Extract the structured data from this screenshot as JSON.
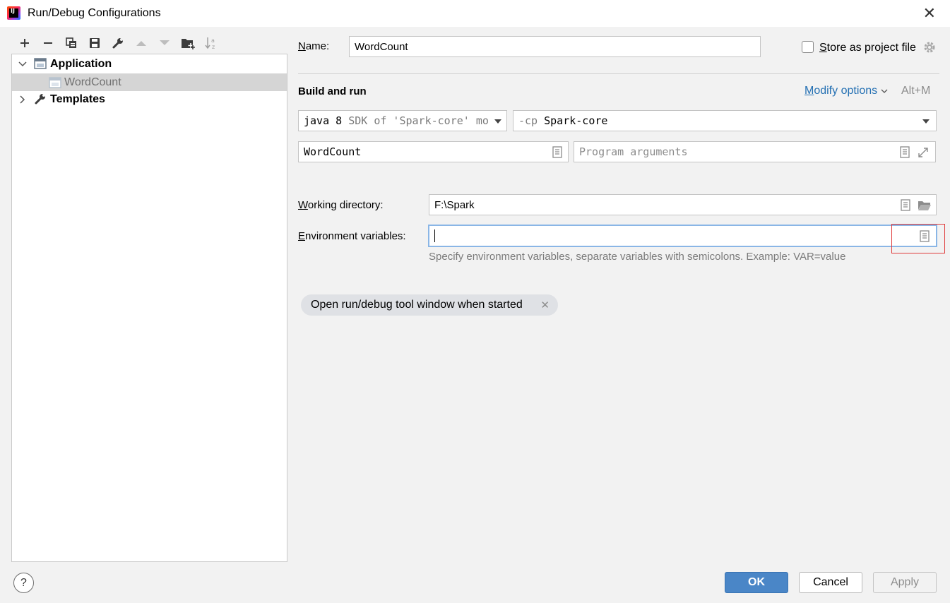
{
  "window": {
    "title": "Run/Debug Configurations",
    "app_icon_text": "IJ"
  },
  "toolbar": {
    "buttons": [
      "plus-icon",
      "minus-icon",
      "copy-icon",
      "save-icon",
      "wrench-icon",
      "arrow-up-icon",
      "arrow-down-icon",
      "new-folder-icon",
      "sort-alpha-icon"
    ]
  },
  "tree": {
    "application_label": "Application",
    "wordcount_label": "WordCount",
    "templates_label": "Templates"
  },
  "form": {
    "name_label": "Name:",
    "name_label_mnemonic": "N",
    "name_label_rest": "ame:",
    "name_value": "WordCount",
    "store_label": "Store as project file",
    "store_label_mnemonic": "S",
    "store_label_rest": "tore as project file",
    "section_title": "Build and run",
    "modify_options": "Modify options",
    "modify_mnemonic": "M",
    "modify_rest": "odify options",
    "modify_shortcut": "Alt+M",
    "jre_main": "java 8",
    "jre_detail": "SDK of 'Spark-core' mo",
    "cp_prefix": "-cp",
    "cp_value": "Spark-core",
    "main_class_value": "WordCount",
    "program_args_placeholder": "Program arguments",
    "working_dir_label": "Working directory:",
    "working_dir_mnemonic": "W",
    "working_dir_rest": "orking directory:",
    "working_dir_value": "F:\\Spark",
    "env_label": "Environment variables:",
    "env_mnemonic": "E",
    "env_rest": "nvironment variables:",
    "env_value": "",
    "env_hint": "Specify environment variables, separate variables with semicolons. Example: VAR=value",
    "chip_label": "Open run/debug tool window when started"
  },
  "buttons": {
    "ok": "OK",
    "cancel": "Cancel",
    "apply": "Apply",
    "help": "?"
  },
  "colors": {
    "ok_button": "#4a86c7",
    "link": "#2470b3",
    "highlight_box": "#e03a3a"
  }
}
